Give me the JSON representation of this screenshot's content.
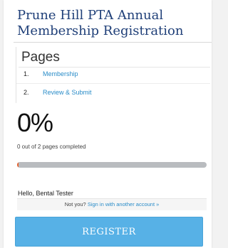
{
  "form": {
    "title": "Prune Hill PTA Annual Membership Registration"
  },
  "pages": {
    "heading": "Pages",
    "items": [
      {
        "number": "1.",
        "label": "Membership"
      },
      {
        "number": "2.",
        "label": "Review & Submit"
      }
    ]
  },
  "progress": {
    "percent_label": "0%",
    "percent_value": 0,
    "completed_text": "0 out of 2 pages completed",
    "fill_color": "#e8602c",
    "track_color": "#b9bcbf"
  },
  "account": {
    "greeting": "Hello, Bental Tester",
    "not_you": "Not you?",
    "switch_link": "Sign in with another account »"
  },
  "actions": {
    "register_label": "REGISTER"
  },
  "colors": {
    "title": "#1f3f78",
    "link": "#2a8cc8",
    "button": "#57b1e6"
  }
}
